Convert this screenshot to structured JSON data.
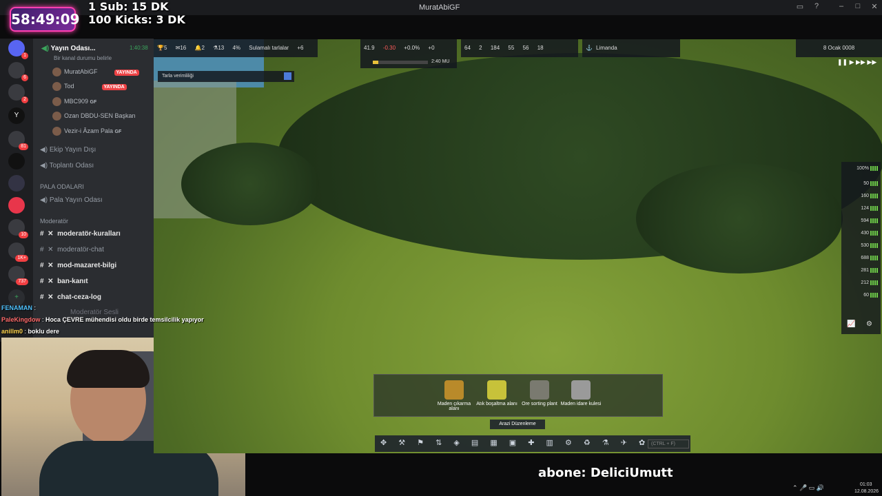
{
  "window": {
    "title": "MuratAbiGF"
  },
  "overlay": {
    "timer": "58:49:09",
    "sub_goal": "1 Sub: 15 DK",
    "kicks_goal": "100 Kicks: 3 DK",
    "subtitle": "abone: DeliciUmutt"
  },
  "discord": {
    "server_name": "MuratAbiGF",
    "voice_channel": {
      "name": "Yayın Odası...",
      "time": "1:40:38",
      "status": "Bir kanal durumu belirle"
    },
    "voice_users": [
      {
        "name": "MuratAbiGF",
        "badge": "YAYINDA"
      },
      {
        "name": "Tod",
        "badge": "YAYINDA"
      },
      {
        "name": "MBC909",
        "badge": "GF"
      },
      {
        "name": "Ozan DBDU-SEN Başkan",
        "badge": ""
      },
      {
        "name": "Vezir-i Âzam Pala",
        "badge": "GF"
      }
    ],
    "channels": [
      "Ekip Yayın Dışı",
      "Toplantı Odası"
    ],
    "sections": [
      "PALA ODALARI",
      "Moderatör"
    ],
    "pala_channel": "Pala Yayın Odası",
    "mod_channels": [
      "moderatör-kuralları",
      "moderatör-chat",
      "mod-mazaret-bilgi",
      "ban-kanıt",
      "chat-ceza-log"
    ],
    "mod_voice": "Moderatör Sesli",
    "server_badges": [
      "1",
      "6",
      "2",
      "81",
      "10",
      "1K+",
      "737"
    ]
  },
  "chat": [
    {
      "user": "FENAMAN",
      "msg": ""
    },
    {
      "user": "PaleKingdow",
      "msg": "Hoca ÇEVRE mühendisi oldu birde temsilcilik yapıyor"
    },
    {
      "user": "anillm0",
      "msg": "boklu dere"
    }
  ],
  "game": {
    "top_left": {
      "count1": "5",
      "count2": "16",
      "count3": "2",
      "count4": "13",
      "pct": "4%",
      "label": "Sulamalı tarlalar",
      "delta": "+6"
    },
    "energy": {
      "a": "41.9",
      "b": "-0.30",
      "pct": "+0.0%",
      "c": "+0",
      "time": "2:40 MU"
    },
    "pop": [
      "64",
      "2",
      "184",
      "55",
      "56",
      "18"
    ],
    "port": "Limanda",
    "date": "8 Ocak 0008",
    "field_tooltip": "Tarla verimliliği",
    "resources": [
      "100%",
      "50",
      "160",
      "124",
      "594",
      "430",
      "530",
      "688",
      "281",
      "212",
      "60"
    ],
    "build_items": [
      "Maden çıkarma alanı",
      "Atık boşaltma alanı",
      "Ore sorting plant",
      "Maden idare kulesi"
    ],
    "terrain_label": "Arazi Düzenleme",
    "search_hint": "(CTRL + F)"
  },
  "taskbar": {
    "time": "01:03",
    "date": "12.08.2026"
  }
}
